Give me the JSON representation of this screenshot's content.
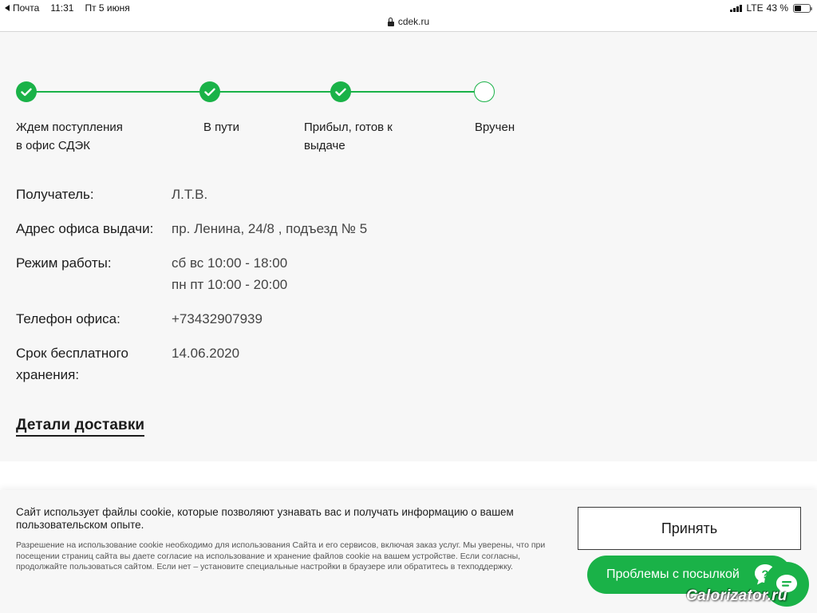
{
  "status_bar": {
    "back_app": "Почта",
    "time": "11:31",
    "date": "Пт 5 июня",
    "network": "LTE",
    "battery": "43 %",
    "battery_level": 0.43
  },
  "url_bar": {
    "domain": "cdek.ru"
  },
  "tracking": {
    "steps": [
      {
        "label_line1": "Ждем поступления",
        "label_line2": "в офис СДЭК",
        "done": true
      },
      {
        "label_line1": "В пути",
        "label_line2": "",
        "done": true
      },
      {
        "label_line1": "Прибыл, готов к",
        "label_line2": "выдаче",
        "done": true
      },
      {
        "label_line1": "Вручен",
        "label_line2": "",
        "done": false
      }
    ],
    "accent_color": "#1ab248"
  },
  "info": {
    "recipient_label": "Получатель:",
    "recipient_value": "Л.Т.В.",
    "office_label": "Адрес офиса выдачи:",
    "office_value": "пр. Ленина, 24/8 , подъезд № 5",
    "hours_label": "Режим работы:",
    "hours_line1": "сб вс 10:00 - 18:00",
    "hours_line2": "пн пт 10:00 - 20:00",
    "phone_label": "Телефон офиса:",
    "phone_value": "+73432907939",
    "storage_label_line1": "Срок бесплатного",
    "storage_label_line2": "хранения:",
    "storage_value": "14.06.2020"
  },
  "details_link": "Детали доставки",
  "cookie": {
    "title": "Сайт использует файлы cookie, которые позволяют узнавать вас и получать информацию о вашем пользовательском опыте.",
    "description": "Разрешение на использование cookie необходимо для использования Сайта и его сервисов, включая заказ услуг. Мы уверены, что при посещении страниц сайта вы даете согласие на использование и хранение файлов cookie на вашем устройстве. Если согласны, продолжайте пользоваться сайтом. Если нет – установите специальные настройки в браузере или обратитесь в техподдержку.",
    "accept_label": "Принять"
  },
  "support": {
    "problems_label": "Проблемы с посылкой",
    "problems_icon": "question-icon",
    "chat_icon": "chat-bubble-icon"
  },
  "watermark": "Calorizator.ru"
}
